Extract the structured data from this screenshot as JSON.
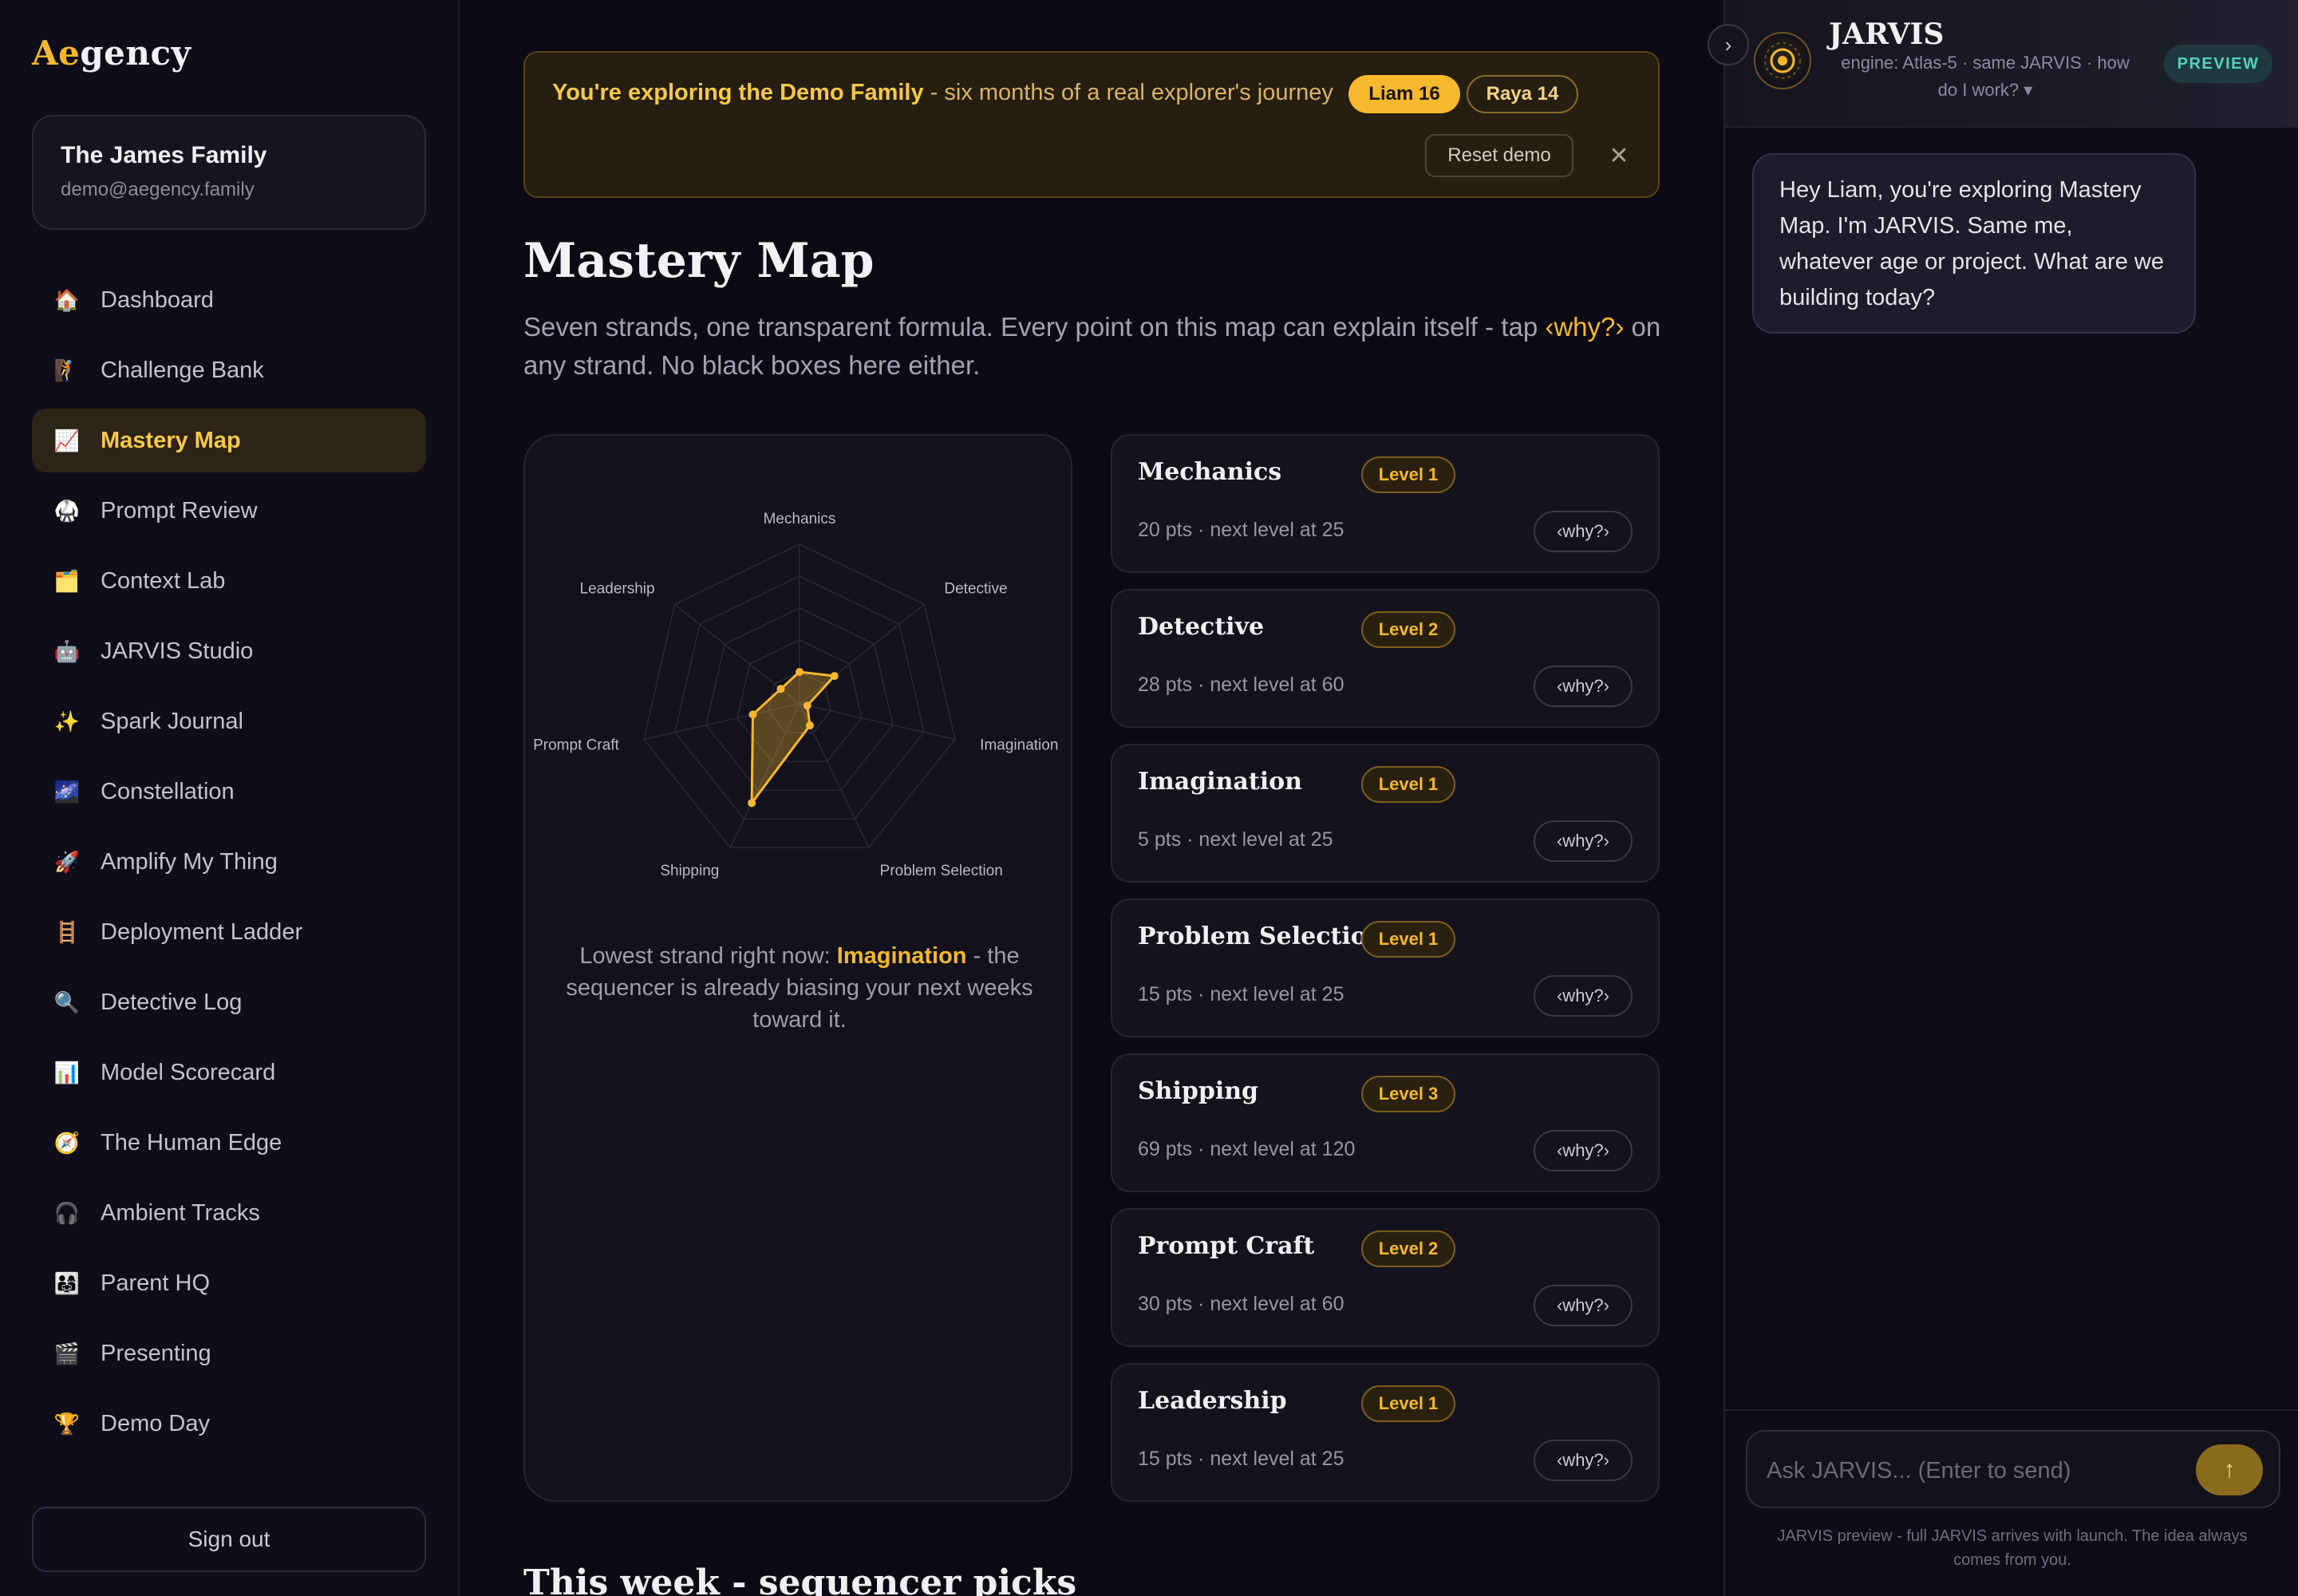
{
  "app": {
    "logo_ae": "Ae",
    "logo_rest": "gency",
    "accent": "#f5b82e"
  },
  "sidebar": {
    "family_name": "The James Family",
    "family_email": "demo@aegency.family",
    "items": [
      {
        "label": "Dashboard",
        "icon": "🏠",
        "icon_name": "house-icon",
        "active": false
      },
      {
        "label": "Challenge Bank",
        "icon": "🧗",
        "icon_name": "climber-icon",
        "active": false
      },
      {
        "label": "Mastery Map",
        "icon": "📈",
        "icon_name": "chart-up-icon",
        "active": true
      },
      {
        "label": "Prompt Review",
        "icon": "🥋",
        "icon_name": "martial-arts-icon",
        "active": false
      },
      {
        "label": "Context Lab",
        "icon": "🗂️",
        "icon_name": "folder-icon",
        "active": false
      },
      {
        "label": "JARVIS Studio",
        "icon": "🤖",
        "icon_name": "robot-icon",
        "active": false
      },
      {
        "label": "Spark Journal",
        "icon": "✨",
        "icon_name": "sparkles-icon",
        "active": false
      },
      {
        "label": "Constellation",
        "icon": "🌌",
        "icon_name": "galaxy-icon",
        "active": false
      },
      {
        "label": "Amplify My Thing",
        "icon": "🚀",
        "icon_name": "rocket-icon",
        "active": false
      },
      {
        "label": "Deployment Ladder",
        "icon": "🪜",
        "icon_name": "ladder-icon",
        "active": false
      },
      {
        "label": "Detective Log",
        "icon": "🔍",
        "icon_name": "magnifier-icon",
        "active": false
      },
      {
        "label": "Model Scorecard",
        "icon": "📊",
        "icon_name": "bar-chart-icon",
        "active": false
      },
      {
        "label": "The Human Edge",
        "icon": "🧭",
        "icon_name": "compass-icon",
        "active": false
      },
      {
        "label": "Ambient Tracks",
        "icon": "🎧",
        "icon_name": "headphones-icon",
        "active": false
      },
      {
        "label": "Parent HQ",
        "icon": "👨‍👩‍👧",
        "icon_name": "family-icon",
        "active": false
      },
      {
        "label": "Presenting",
        "icon": "🎬",
        "icon_name": "clapper-icon",
        "active": false
      },
      {
        "label": "Demo Day",
        "icon": "🏆",
        "icon_name": "trophy-icon",
        "active": false
      }
    ],
    "signout": "Sign out"
  },
  "banner": {
    "strong": "You're exploring the Demo Family",
    "rest": " - six months of a real explorer's journey",
    "pill_1": "Liam 16",
    "pill_2": "Raya 14",
    "reset": "Reset demo",
    "close": "✕"
  },
  "page": {
    "title": "Mastery Map",
    "desc_before": "Seven strands, one transparent formula. Every point on this map can explain itself - tap ",
    "desc_why": "‹why?›",
    "desc_after": " on any strand. No black boxes here either.",
    "lowest_before": "Lowest strand right now: ",
    "lowest_strand": "Imagination",
    "lowest_after": " - the sequencer is already biasing your next weeks toward it.",
    "section_title": "This week - sequencer picks"
  },
  "chart_data": {
    "type": "radar",
    "axes": [
      "Mechanics",
      "Detective",
      "Imagination",
      "Problem Selection",
      "Shipping",
      "Prompt Craft",
      "Leadership"
    ],
    "values": [
      20,
      28,
      5,
      15,
      69,
      30,
      15
    ],
    "range": [
      0,
      100
    ],
    "rings": 5,
    "fill_color": "#f5b82e"
  },
  "strands": [
    {
      "name": "Mechanics",
      "level": "Level 1",
      "pts": "20 pts · next level at 25",
      "why": "‹why?›"
    },
    {
      "name": "Detective",
      "level": "Level 2",
      "pts": "28 pts · next level at 60",
      "why": "‹why?›"
    },
    {
      "name": "Imagination",
      "level": "Level 1",
      "pts": "5 pts · next level at 25",
      "why": "‹why?›"
    },
    {
      "name": "Problem Selection",
      "level": "Level 1",
      "pts": "15 pts · next level at 25",
      "why": "‹why?›"
    },
    {
      "name": "Shipping",
      "level": "Level 3",
      "pts": "69 pts · next level at 120",
      "why": "‹why?›"
    },
    {
      "name": "Prompt Craft",
      "level": "Level 2",
      "pts": "30 pts · next level at 60",
      "why": "‹why?›"
    },
    {
      "name": "Leadership",
      "level": "Level 1",
      "pts": "15 pts · next level at 25",
      "why": "‹why?›"
    }
  ],
  "jarvis": {
    "collapse": "›",
    "name": "JARVIS",
    "engine": "engine: Atlas-5 · same JARVIS · how do I work? ▾",
    "badge": "PREVIEW",
    "message": "Hey Liam, you're exploring Mastery Map. I'm JARVIS. Same me, whatever age or project. What are we building today?",
    "input_placeholder": "Ask JARVIS... (Enter to send)",
    "send": "↑",
    "note": "JARVIS preview - full JARVIS arrives with launch. The idea always comes from you."
  }
}
